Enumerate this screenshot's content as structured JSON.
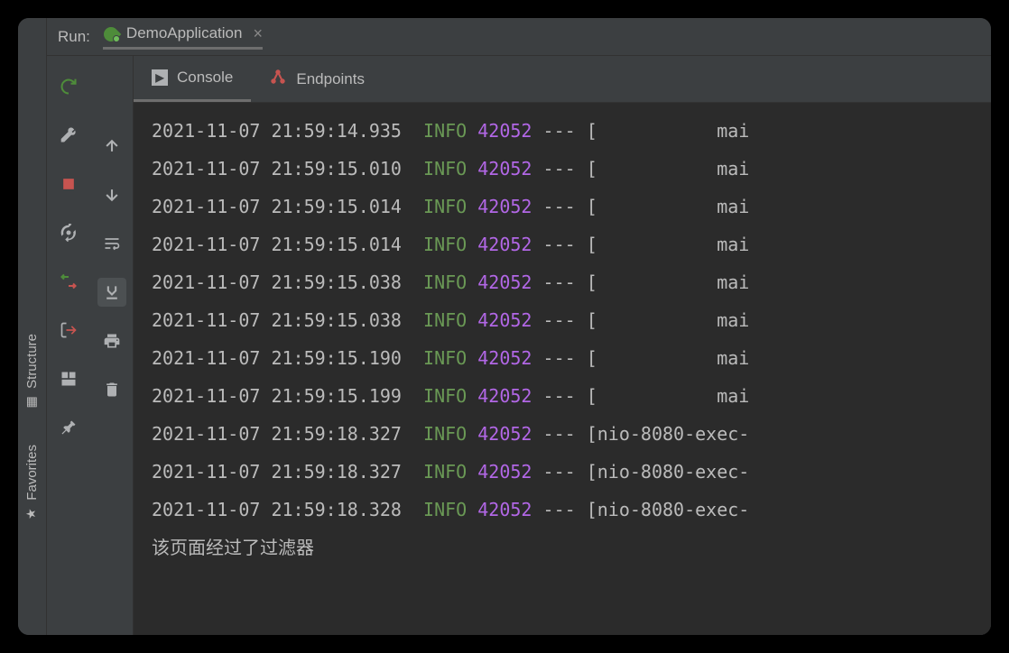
{
  "run_panel": {
    "title": "Run:",
    "config_name": "DemoApplication"
  },
  "left_sidebar": {
    "structure_label": "Structure",
    "favorites_label": "Favorites"
  },
  "tabs": {
    "console": "Console",
    "endpoints": "Endpoints"
  },
  "log_lines": [
    {
      "timestamp": "2021-11-07 21:59:14.935",
      "level": "INFO",
      "pid": "42052",
      "sep": "---",
      "thread": "[           mai"
    },
    {
      "timestamp": "2021-11-07 21:59:15.010",
      "level": "INFO",
      "pid": "42052",
      "sep": "---",
      "thread": "[           mai"
    },
    {
      "timestamp": "2021-11-07 21:59:15.014",
      "level": "INFO",
      "pid": "42052",
      "sep": "---",
      "thread": "[           mai"
    },
    {
      "timestamp": "2021-11-07 21:59:15.014",
      "level": "INFO",
      "pid": "42052",
      "sep": "---",
      "thread": "[           mai"
    },
    {
      "timestamp": "2021-11-07 21:59:15.038",
      "level": "INFO",
      "pid": "42052",
      "sep": "---",
      "thread": "[           mai"
    },
    {
      "timestamp": "2021-11-07 21:59:15.038",
      "level": "INFO",
      "pid": "42052",
      "sep": "---",
      "thread": "[           mai"
    },
    {
      "timestamp": "2021-11-07 21:59:15.190",
      "level": "INFO",
      "pid": "42052",
      "sep": "---",
      "thread": "[           mai"
    },
    {
      "timestamp": "2021-11-07 21:59:15.199",
      "level": "INFO",
      "pid": "42052",
      "sep": "---",
      "thread": "[           mai"
    },
    {
      "timestamp": "2021-11-07 21:59:18.327",
      "level": "INFO",
      "pid": "42052",
      "sep": "---",
      "thread": "[nio-8080-exec-"
    },
    {
      "timestamp": "2021-11-07 21:59:18.327",
      "level": "INFO",
      "pid": "42052",
      "sep": "---",
      "thread": "[nio-8080-exec-"
    },
    {
      "timestamp": "2021-11-07 21:59:18.328",
      "level": "INFO",
      "pid": "42052",
      "sep": "---",
      "thread": "[nio-8080-exec-"
    }
  ],
  "output_message": "该页面经过了过滤器"
}
